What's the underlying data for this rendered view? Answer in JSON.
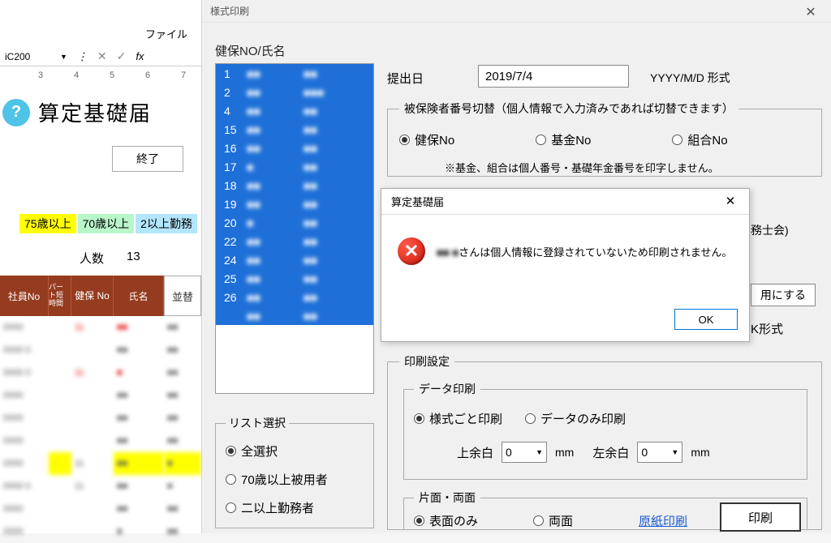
{
  "menu": {
    "file": "ファイル"
  },
  "formula": {
    "cell_ref": "iC200",
    "ellipsis": "⋮",
    "x": "✕",
    "check": "✓",
    "fx": "fx"
  },
  "col_headers": [
    "3",
    "4",
    "5",
    "6",
    "7"
  ],
  "title": "算定基礎届",
  "buttons": {
    "exit": "終了",
    "sort": "並替",
    "ok": "OK",
    "print": "印刷"
  },
  "legend": {
    "age75": "75歳以上",
    "age70": "70歳以上",
    "multi": "2以上勤務"
  },
  "count": {
    "label": "人数",
    "value": "13"
  },
  "table_headers": {
    "emp_no": "社員No",
    "parttime": "パー\nト短\n時間",
    "kenpo_no": "健保\nNo",
    "name": "氏名"
  },
  "grid_rows": [
    {
      "c1": "0000",
      "c2": "",
      "c3": "11",
      "c4": "■■",
      "c5": "■■",
      "red": true
    },
    {
      "c1": "0000 0",
      "c2": "",
      "c3": "",
      "c4": "■■",
      "c5": "■■"
    },
    {
      "c1": "0000 0",
      "c2": "",
      "c3": "11",
      "c4": "■",
      "c5": "■■",
      "red": true
    },
    {
      "c1": "0000",
      "c2": "",
      "c3": "",
      "c4": "■■",
      "c5": "■■"
    },
    {
      "c1": "0000",
      "c2": "",
      "c3": "",
      "c4": "■■",
      "c5": "■■"
    },
    {
      "c1": "0000",
      "c2": "",
      "c3": "",
      "c4": "■■",
      "c5": "■■"
    },
    {
      "c1": "0000",
      "c2": "·",
      "c3": "11",
      "c4": "■■",
      "c5": "■",
      "hl2": true,
      "hl4": true,
      "hl5": true
    },
    {
      "c1": "0000 0",
      "c2": "",
      "c3": "11",
      "c4": "■■",
      "c5": "■"
    },
    {
      "c1": "0000",
      "c2": "",
      "c3": "",
      "c4": "■■",
      "c5": "■■"
    },
    {
      "c1": "0000",
      "c2": "",
      "c3": "",
      "c4": "■",
      "c5": "■■"
    }
  ],
  "dialog": {
    "title": "様式印刷",
    "kenpo_label": "健保NO/氏名",
    "list": [
      {
        "no": "1",
        "n1": "■■",
        "n2": "■■"
      },
      {
        "no": "2",
        "n1": "■■",
        "n2": "■■■"
      },
      {
        "no": "4",
        "n1": "■■",
        "n2": "■■"
      },
      {
        "no": "15",
        "n1": "■■",
        "n2": "■■"
      },
      {
        "no": "16",
        "n1": "■■",
        "n2": "■■"
      },
      {
        "no": "17",
        "n1": "■",
        "n2": "■■"
      },
      {
        "no": "18",
        "n1": "■■",
        "n2": "■■"
      },
      {
        "no": "19",
        "n1": "■■",
        "n2": "■■"
      },
      {
        "no": "20",
        "n1": "■",
        "n2": "■■"
      },
      {
        "no": "22",
        "n1": "■■",
        "n2": "■■"
      },
      {
        "no": "24",
        "n1": "■■",
        "n2": "■■"
      },
      {
        "no": "25",
        "n1": "■■",
        "n2": "■■"
      },
      {
        "no": "26",
        "n1": "■■",
        "n2": "■■"
      },
      {
        "no": "",
        "n1": "■■",
        "n2": "■■"
      }
    ],
    "submit_date_label": "提出日",
    "submit_date_value": "2019/7/4",
    "date_format": "YYYY/M/D 形式",
    "switch": {
      "legend": "被保険者番号切替（個人情報で入力済みであれば切替できます）",
      "opt1": "健保No",
      "opt2": "基金No",
      "opt3": "組合No",
      "note": "※基金、組合は個人番号・基礎年金番号を印字しません。"
    },
    "partial1": "務士会)",
    "partial2": "用にする",
    "partial_k": "K形式",
    "list_select": {
      "legend": "リスト選択",
      "opt1": "全選択",
      "opt2": "70歳以上被用者",
      "opt3": "二以上勤務者"
    },
    "print": {
      "legend": "印刷設定",
      "data_legend": "データ印刷",
      "opt1": "様式ごと印刷",
      "opt2": "データのみ印刷",
      "margin_top": "上余白",
      "margin_left": "左余白",
      "margin_val": "0",
      "unit": "mm",
      "side_legend": "片面・両面",
      "side_opt1": "表面のみ",
      "side_opt2": "両面",
      "gensai": "原紙印刷"
    }
  },
  "msg": {
    "title": "算定基礎届",
    "blur1": "■■",
    "blur2": "■",
    "text": "さんは個人情報に登録されていないため印刷されません。"
  }
}
